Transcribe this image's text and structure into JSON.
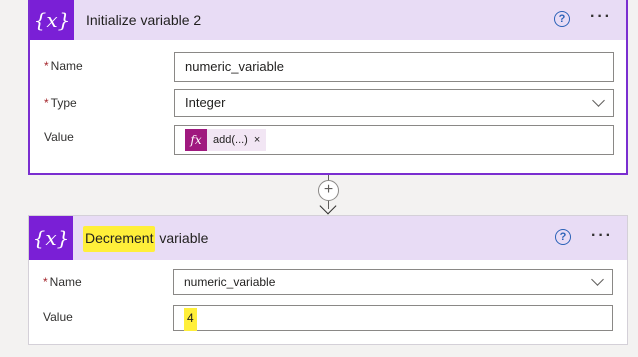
{
  "card1": {
    "title": "Initialize variable 2",
    "name_label": "Name",
    "name_value": "numeric_variable",
    "type_label": "Type",
    "type_value": "Integer",
    "value_label": "Value",
    "token_fx": "fx",
    "token_text": "add(...)",
    "token_remove": "×",
    "help": "?",
    "more": "···",
    "icon": "{x}"
  },
  "connector": {
    "plus": "+"
  },
  "card2": {
    "title_highlighted": "Decrement",
    "title_rest": " variable",
    "name_label": "Name",
    "name_value": "numeric_variable",
    "value_label": "Value",
    "value_value": "4",
    "help": "?",
    "more": "···",
    "icon": "{x}"
  },
  "colors": {
    "accent": "#7a1fd6",
    "highlight": "#ffef3a",
    "fx": "#a0197f",
    "required": "#a4262c"
  }
}
